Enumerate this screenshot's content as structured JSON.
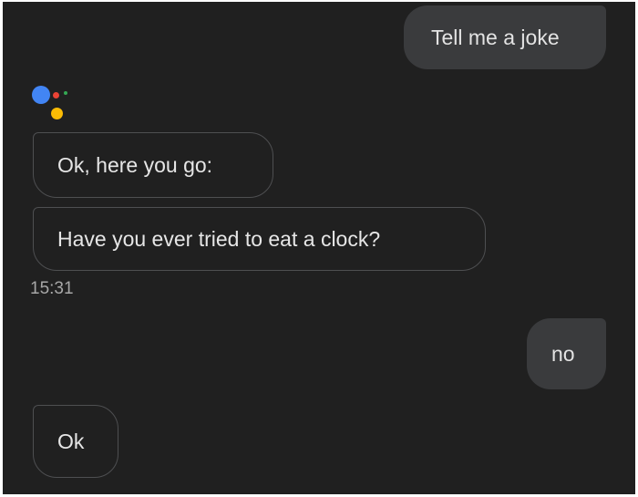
{
  "conversation": {
    "assistant_icon": "google-assistant-icon",
    "messages": [
      {
        "sender": "user",
        "text": "Tell me a joke"
      },
      {
        "sender": "assistant",
        "text": "Ok, here you go:"
      },
      {
        "sender": "assistant",
        "text": "Have you ever tried to eat a clock?"
      },
      {
        "sender": "timestamp",
        "text": "15:31"
      },
      {
        "sender": "user",
        "text": "no"
      },
      {
        "sender": "assistant",
        "text": "Ok"
      }
    ]
  },
  "colors": {
    "background": "#202020",
    "user_bubble": "#3a3b3d",
    "assistant_border": "#4e4f51",
    "logo_blue": "#4285f4",
    "logo_red": "#ea4335",
    "logo_yellow": "#fbbc05",
    "logo_green": "#34a853"
  }
}
